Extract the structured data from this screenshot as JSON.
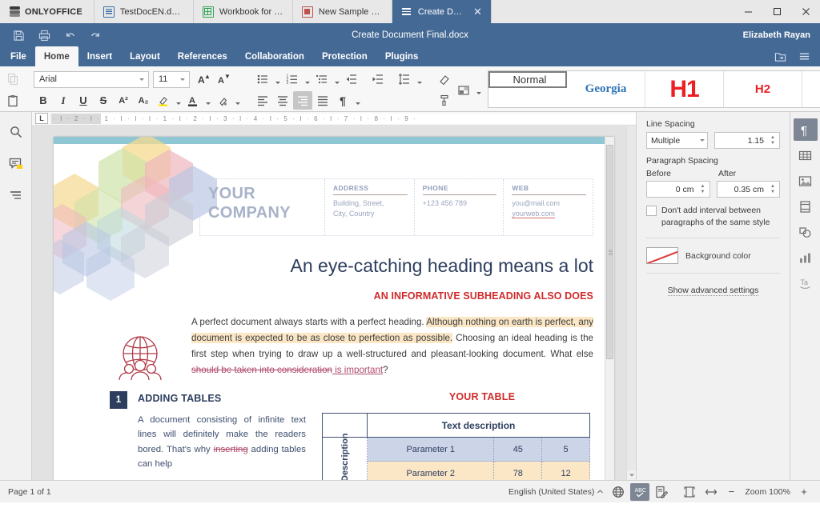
{
  "app": {
    "brand": "ONLYOFFICE"
  },
  "tabs": [
    {
      "label": "TestDocEN.docx",
      "icon": "document-icon",
      "type": "doc",
      "active": false
    },
    {
      "label": "Workbook for t...",
      "icon": "spreadsheet-icon",
      "type": "xls",
      "active": false
    },
    {
      "label": "New Sample Pr...",
      "icon": "presentation-icon",
      "type": "ppt",
      "active": false
    },
    {
      "label": "Create Docume...",
      "icon": "menu-icon",
      "type": "burger",
      "active": true
    }
  ],
  "window": {
    "minimize": "minimize-icon",
    "maximize": "maximize-icon",
    "close": "close-icon"
  },
  "titlebar": {
    "title": "Create Document Final.docx",
    "user": "Elizabeth Rayan",
    "quick_access": [
      "save-icon",
      "print-icon",
      "undo-icon",
      "redo-icon"
    ]
  },
  "menu": {
    "items": [
      "File",
      "Home",
      "Insert",
      "Layout",
      "References",
      "Collaboration",
      "Protection",
      "Plugins"
    ],
    "active": "Home",
    "right_icons": [
      "open-location-icon",
      "view-settings-icon"
    ]
  },
  "ribbon": {
    "copy_icon": "copy-icon",
    "paste_icon": "paste-icon",
    "font": {
      "name": "Arial",
      "size": "11"
    },
    "increase_font": "increase-font-size-icon",
    "decrease_font": "decrease-font-size-icon",
    "bold": "B",
    "italic": "I",
    "underline": "U",
    "strikethrough": "S",
    "superscript": "A²",
    "subscript": "A₂",
    "highlight_icon": "highlight-color-icon",
    "fontcolor_icon": "font-color-icon",
    "shading_icon": "shading-icon",
    "bullets_icon": "bullet-list-icon",
    "numbering_icon": "numbered-list-icon",
    "multilevel_icon": "multilevel-list-icon",
    "decrease_indent_icon": "decrease-indent-icon",
    "increase_indent_icon": "increase-indent-icon",
    "linespacing_icon": "line-spacing-icon",
    "align_left_icon": "align-left-icon",
    "align_center_icon": "align-center-icon",
    "align_right_icon": "align-right-icon",
    "align_justify_icon": "align-justify-icon",
    "pilcrow_icon": "show-formatting-marks-icon",
    "clear_style_icon": "clear-style-icon",
    "color_scheme_icon": "color-scheme-icon",
    "copy_style_icon": "copy-style-icon",
    "styles": [
      {
        "label": "Normal",
        "kind": "normal",
        "selected": true
      },
      {
        "label": "Georgia",
        "kind": "georgia",
        "selected": false
      },
      {
        "label": "H1",
        "kind": "h1",
        "selected": false
      },
      {
        "label": "H2",
        "kind": "h2",
        "selected": false
      }
    ],
    "styles_more_icon": "expand-styles-icon"
  },
  "left_rail": [
    {
      "name": "search-icon",
      "label": "Find"
    },
    {
      "name": "comments-icon",
      "label": "Comments"
    },
    {
      "name": "headings-icon",
      "label": "Headings"
    }
  ],
  "ruler": {
    "tab_stop": "L",
    "marks": "· I · 2 · I · 1 · I · I · I · 1 · I · 2 · I · 3 · I · 4 · I · 5 · I · 6 · I · 7 · I · 8 · I · 9 ·"
  },
  "document": {
    "letterhead": {
      "company_line1": "YOUR",
      "company_line2": "COMPANY",
      "columns": [
        {
          "header": "ADDRESS",
          "lines": [
            "Building, Street,",
            "City, Country"
          ]
        },
        {
          "header": "PHONE",
          "lines": [
            "+123 456 789"
          ]
        },
        {
          "header": "WEB",
          "lines": [
            "you@mail.com",
            "yourweb.com"
          ]
        }
      ]
    },
    "heading": "An eye-catching heading means a lot",
    "subheading": "AN INFORMATIVE SUBHEADING ALSO DOES",
    "paragraph": {
      "plain1": "A perfect document always starts with a perfect heading. ",
      "highlighted": "Although nothing on earth is perfect, any document is expected to be as close to perfection as possible.",
      "plain2": " Choosing an ideal heading is the first step when trying to draw up a well-structured and pleasant-looking document. What else ",
      "deleted": "should be taken into consideration",
      "inserted": " is important",
      "plain3": "?"
    },
    "section": {
      "number": "1",
      "heading": "ADDING TABLES",
      "text_before": "A document consisting of infinite text lines will definitely make the readers bored. That's why ",
      "deleted": "inserting",
      "text_after": " adding tables can help"
    },
    "table": {
      "title": "YOUR TABLE",
      "caption": "Description",
      "header": "Text description",
      "rows": [
        {
          "cells": [
            "Parameter 1",
            "45",
            "5"
          ],
          "shade": "blue"
        },
        {
          "cells": [
            "Parameter 2",
            "78",
            "12"
          ],
          "shade": "amber"
        }
      ]
    },
    "decor": {
      "hexagons": "hexagon-pattern",
      "illustration": "globe-people-icon"
    }
  },
  "right_panel": {
    "line_spacing_label": "Line Spacing",
    "line_spacing_mode": "Multiple",
    "line_spacing_value": "1.15",
    "paragraph_spacing_label": "Paragraph Spacing",
    "before_label": "Before",
    "before_value": "0 cm",
    "after_label": "After",
    "after_value": "0.35 cm",
    "checkbox_label": "Don't add interval between paragraphs of the same style",
    "checkbox_checked": false,
    "background_color_label": "Background color",
    "background_color": "#ffffff",
    "advanced_label": "Show advanced settings"
  },
  "right_rail": [
    {
      "name": "paragraph-settings-icon",
      "active": true
    },
    {
      "name": "table-settings-icon",
      "active": false
    },
    {
      "name": "image-settings-icon",
      "active": false
    },
    {
      "name": "header-footer-settings-icon",
      "active": false
    },
    {
      "name": "shape-settings-icon",
      "active": false
    },
    {
      "name": "chart-settings-icon",
      "active": false
    },
    {
      "name": "text-art-settings-icon",
      "active": false
    }
  ],
  "statusbar": {
    "page_info": "Page 1 of 1",
    "language": "English (United States)",
    "set_language_icon": "language-icon",
    "spellcheck_icon": "spellcheck-icon",
    "track_changes_icon": "track-changes-icon",
    "fit_page_icon": "fit-page-icon",
    "fit_width_icon": "fit-width-icon",
    "zoom_out": "−",
    "zoom_label": "Zoom 100%",
    "zoom_in": "+"
  },
  "colors": {
    "accent": "#446995",
    "heading": "#2d3e5e",
    "red": "#d02b2b",
    "highlight": "#fbe7c6"
  }
}
